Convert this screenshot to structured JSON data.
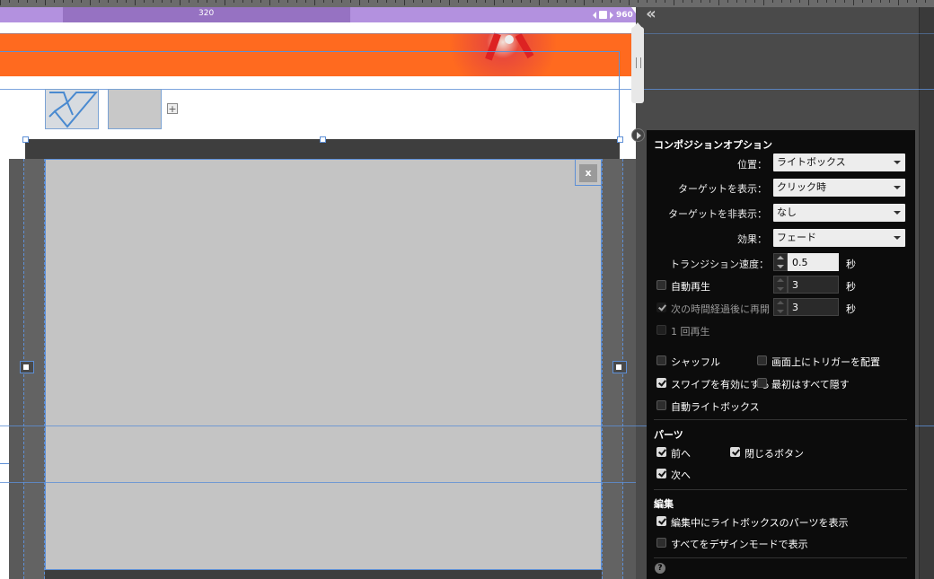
{
  "breakpoints": {
    "min": "320",
    "max": "960"
  },
  "lightbox": {
    "close_label": "x"
  },
  "panel": {
    "title": "コンポジションオプション",
    "position": {
      "label": "位置：",
      "value": "ライトボックス"
    },
    "show_target": {
      "label": "ターゲットを表示：",
      "value": "クリック時"
    },
    "hide_target": {
      "label": "ターゲットを非表示：",
      "value": "なし"
    },
    "effect": {
      "label": "効果：",
      "value": "フェード"
    },
    "transition_speed": {
      "label": "トランジション速度：",
      "value": "0.5",
      "unit": "秒"
    },
    "autoplay": {
      "label": "自動再生",
      "value": "3",
      "unit": "秒",
      "checked": false
    },
    "resume": {
      "label": "次の時間経過後に再開",
      "value": "3",
      "unit": "秒",
      "checked": true
    },
    "play_once": {
      "label": "1 回再生",
      "checked": false
    },
    "shuffle": {
      "label": "シャッフル",
      "checked": false
    },
    "triggers_on_screen": {
      "label": "画面上にトリガーを配置",
      "checked": false
    },
    "enable_swipe": {
      "label": "スワイプを有効にする",
      "checked": true
    },
    "hide_all_initially": {
      "label": "最初はすべて隠す",
      "checked": false
    },
    "auto_lightbox": {
      "label": "自動ライトボックス",
      "checked": false
    },
    "parts": {
      "title": "パーツ",
      "prev": {
        "label": "前へ",
        "checked": true
      },
      "close": {
        "label": "閉じるボタン",
        "checked": true
      },
      "next": {
        "label": "次へ",
        "checked": true
      }
    },
    "editing": {
      "title": "編集",
      "show_parts": {
        "label": "編集中にライトボックスのパーツを表示",
        "checked": true
      },
      "design_mode": {
        "label": "すべてをデザインモードで表示",
        "checked": false
      }
    },
    "help": "?"
  }
}
